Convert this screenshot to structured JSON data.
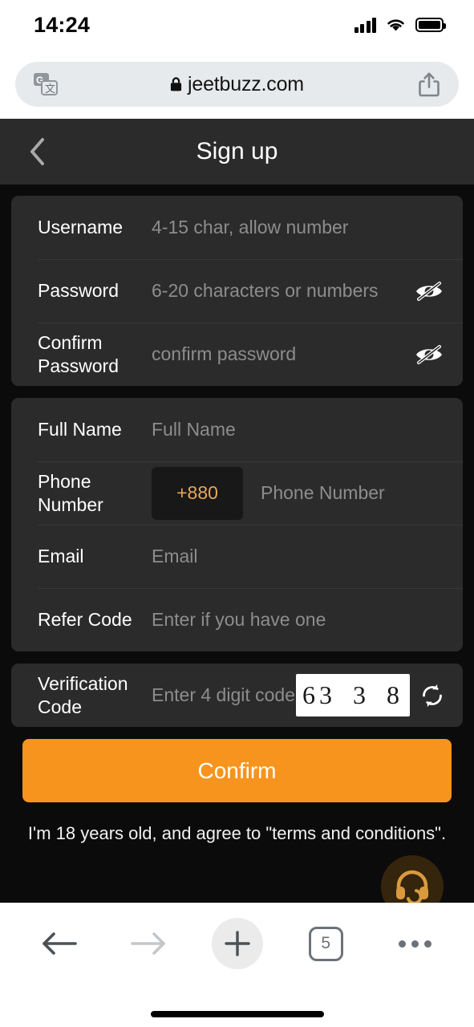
{
  "status_bar": {
    "time": "14:24",
    "signal_icon": "cellular-signal-icon",
    "wifi_icon": "wifi-icon",
    "battery_icon": "battery-full-icon"
  },
  "browser": {
    "translate_icon": "google-translate-icon",
    "lock_icon": "lock-icon",
    "url": "jeetbuzz.com",
    "share_icon": "share-icon",
    "toolbar": {
      "back_icon": "arrow-left-icon",
      "forward_icon": "arrow-right-icon",
      "new_tab_icon": "plus-icon",
      "tab_count": "5",
      "more_icon": "more-dots-icon"
    }
  },
  "app": {
    "header": {
      "back_icon": "chevron-left-icon",
      "title": "Sign up"
    },
    "groups": [
      {
        "rows": [
          {
            "label": "Username",
            "placeholder": "4-15 char, allow number",
            "trailing_icon": ""
          },
          {
            "label": "Password",
            "placeholder": "6-20 characters or numbers",
            "trailing_icon": "eye-off-icon"
          },
          {
            "label": "Confirm Password",
            "placeholder": "confirm password",
            "trailing_icon": "eye-off-icon"
          }
        ]
      },
      {
        "rows": [
          {
            "label": "Full Name",
            "placeholder": "Full Name",
            "trailing_icon": ""
          },
          {
            "label": "Phone Number",
            "prefix": "+880",
            "placeholder": "Phone Number",
            "trailing_icon": ""
          },
          {
            "label": "Email",
            "placeholder": "Email",
            "trailing_icon": ""
          },
          {
            "label": "Refer Code",
            "placeholder": "Enter if you have one",
            "trailing_icon": ""
          }
        ]
      },
      {
        "rows": [
          {
            "label": "Verification Code",
            "placeholder": "Enter 4 digit code",
            "captcha_text": "63 3 8",
            "trailing_icon": "refresh-icon"
          }
        ]
      }
    ],
    "confirm_label": "Confirm",
    "terms_text": "I'm 18 years old, and agree to \"terms and conditions\".",
    "support_icon": "headset-support-icon"
  },
  "colors": {
    "accent_orange": "#f7941d",
    "prefix_orange": "#e8a75a",
    "card_bg": "#2b2b2b",
    "page_bg": "#0b0b0b",
    "placeholder": "#8d8d8d"
  }
}
